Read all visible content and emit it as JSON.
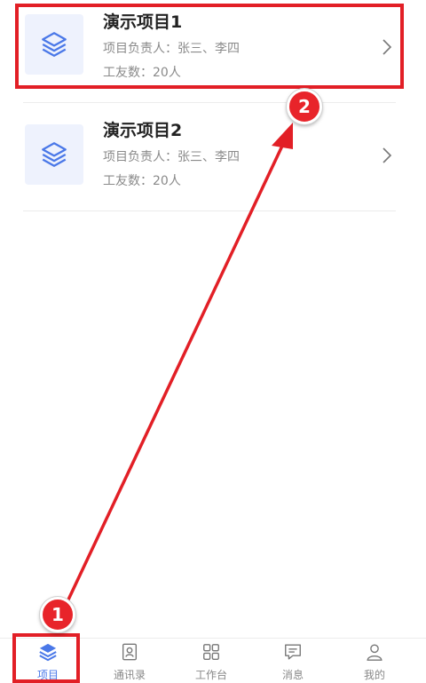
{
  "projects": [
    {
      "title": "演示项目1",
      "owner": "项目负责人：张三、李四",
      "workers": "工友数：20人"
    },
    {
      "title": "演示项目2",
      "owner": "项目负责人：张三、李四",
      "workers": "工友数：20人"
    }
  ],
  "annotations": {
    "step1": "1",
    "step2": "2",
    "color": "#e21f26"
  },
  "tabs": [
    {
      "label": "项目",
      "icon": "layers-icon",
      "active": true
    },
    {
      "label": "通讯录",
      "icon": "contacts-icon",
      "active": false
    },
    {
      "label": "工作台",
      "icon": "grid-icon",
      "active": false
    },
    {
      "label": "消息",
      "icon": "message-icon",
      "active": false
    },
    {
      "label": "我的",
      "icon": "user-icon",
      "active": false
    }
  ],
  "colors": {
    "accent": "#4a78e8",
    "thumb_bg": "#eef2fd"
  }
}
